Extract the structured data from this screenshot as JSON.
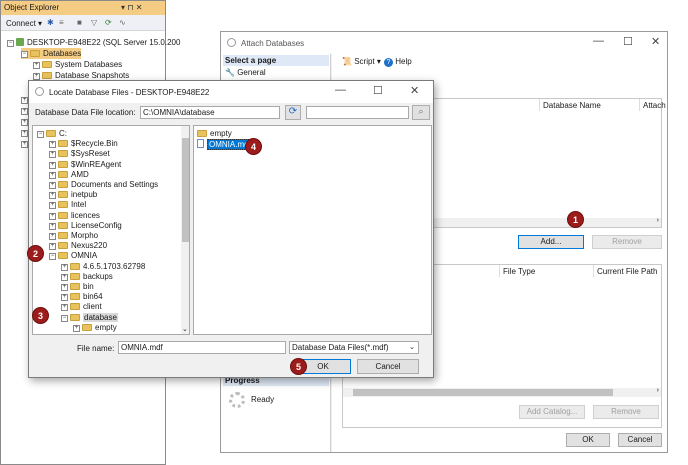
{
  "object_explorer": {
    "title": "Object Explorer",
    "pin": "▾ ⊓ ✕",
    "connect_label": "Connect",
    "toolbar_icons": [
      "connect-icon",
      "filter-icon",
      "refresh-icon",
      "activity-icon"
    ],
    "server": "DESKTOP-E948E22 (SQL Server 15.0.200",
    "nodes": [
      "Databases",
      "System Databases",
      "Database Snapshots"
    ]
  },
  "attach": {
    "title": "Attach Databases",
    "select_page": "Select a page",
    "page_general": "General",
    "toolbar_script": "Script",
    "toolbar_help": "Help",
    "col_database_name": "Database Name",
    "col_attach": "Attach",
    "add_label": "Add...",
    "remove_label": "Remove",
    "col_file_type": "File Type",
    "col_current_path": "Current File Path",
    "add_catalog_label": "Add Catalog...",
    "remove2_label": "Remove",
    "progress_label": "Progress",
    "ready_label": "Ready",
    "ok_label": "OK",
    "cancel_label": "Cancel"
  },
  "locate": {
    "title": "Locate Database Files - DESKTOP-E948E22",
    "location_label": "Database Data File location:",
    "location_value": "C:\\OMNIA\\database",
    "search_value": "",
    "tree": [
      {
        "label": "C:",
        "level": 0,
        "sign": "−"
      },
      {
        "label": "$Recycle.Bin",
        "level": 1,
        "sign": "+"
      },
      {
        "label": "$SysReset",
        "level": 1,
        "sign": "+"
      },
      {
        "label": "$WinREAgent",
        "level": 1,
        "sign": "+"
      },
      {
        "label": "AMD",
        "level": 1,
        "sign": "+"
      },
      {
        "label": "Documents and Settings",
        "level": 1,
        "sign": "+"
      },
      {
        "label": "inetpub",
        "level": 1,
        "sign": "+"
      },
      {
        "label": "Intel",
        "level": 1,
        "sign": "+"
      },
      {
        "label": "licences",
        "level": 1,
        "sign": "+"
      },
      {
        "label": "LicenseConfig",
        "level": 1,
        "sign": "+"
      },
      {
        "label": "Morpho",
        "level": 1,
        "sign": "+"
      },
      {
        "label": "Nexus220",
        "level": 1,
        "sign": "+"
      },
      {
        "label": "OMNIA",
        "level": 1,
        "sign": "−"
      },
      {
        "label": "4.6.5.1703.62798",
        "level": 2,
        "sign": "+"
      },
      {
        "label": "backups",
        "level": 2,
        "sign": "+"
      },
      {
        "label": "bin",
        "level": 2,
        "sign": "+"
      },
      {
        "label": "bin64",
        "level": 2,
        "sign": "+"
      },
      {
        "label": "client",
        "level": 2,
        "sign": "+"
      },
      {
        "label": "database",
        "level": 2,
        "sign": "−"
      },
      {
        "label": "empty",
        "level": 3,
        "sign": "+"
      }
    ],
    "files": [
      "empty",
      "OMNIA.mdf"
    ],
    "file_name_label": "File name:",
    "file_name_value": "OMNIA.mdf",
    "file_type_value": "Database Data Files(*.mdf)",
    "ok_label": "OK",
    "cancel_label": "Cancel"
  },
  "badges": [
    "1",
    "2",
    "3",
    "4",
    "5"
  ],
  "colors": {
    "accent": "#0078d7",
    "badge": "#9c1b1b",
    "oe_title": "#f5cc84"
  }
}
